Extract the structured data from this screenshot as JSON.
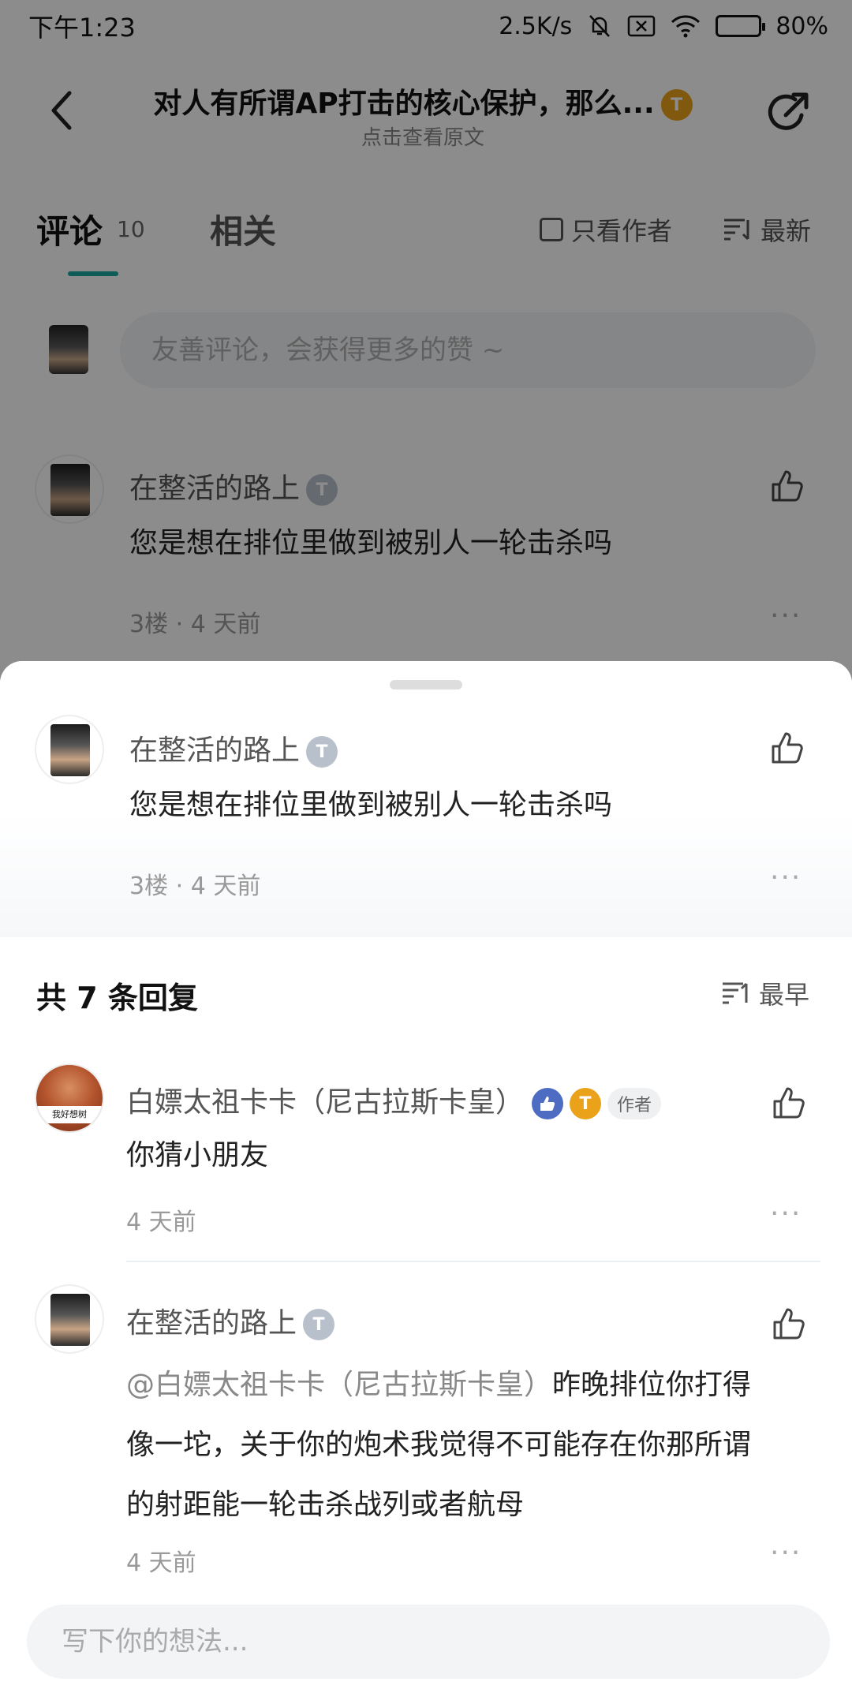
{
  "status_bar": {
    "time": "下午1:23",
    "net_speed": "2.5K/s",
    "battery": "80%"
  },
  "nav": {
    "title": "对人有所谓AP打击的核心保护，那么...",
    "subtitle": "点击查看原文",
    "title_badge": "T"
  },
  "tabs": {
    "comments_label": "评论",
    "comments_count": "10",
    "related_label": "相关",
    "author_only_label": "只看作者",
    "sort_label": "最新"
  },
  "comment_input": {
    "placeholder": "友善评论，会获得更多的赞 ~"
  },
  "background_comment": {
    "user": "在整活的路上",
    "badge": "T",
    "text": "您是想在排位里做到被别人一轮击杀吗",
    "floor": "3楼",
    "time": "4 天前"
  },
  "sheet": {
    "main_comment": {
      "user": "在整活的路上",
      "badge": "T",
      "text": "您是想在排位里做到被别人一轮击杀吗",
      "floor": "3楼",
      "time": "4 天前"
    },
    "reply_count_label": "共 7 条回复",
    "reply_sort_label": "最早",
    "replies": [
      {
        "user": "白嫖太祖卡卡（尼古拉斯卡皇）",
        "author_tag": "作者",
        "avatar_caption": "我好想树",
        "text": "你猜小朋友",
        "time": "4 天前"
      },
      {
        "user": "在整活的路上",
        "mention": "@白嫖太祖卡卡（尼古拉斯卡皇）",
        "text_line1": "昨晚排位你打得",
        "text_line2": "像一坨，关于你的炮术我觉得不可能存在你那所谓",
        "text_line3": "的射距能一轮击杀战列或者航母",
        "time": "4 天前"
      }
    ],
    "bottom_input_placeholder": "写下你的想法..."
  },
  "colors": {
    "accent": "#1aa7a0",
    "gold_badge": "#e9a21a",
    "silver_badge": "#b8c0cc",
    "like_badge": "#4e6cc2"
  }
}
